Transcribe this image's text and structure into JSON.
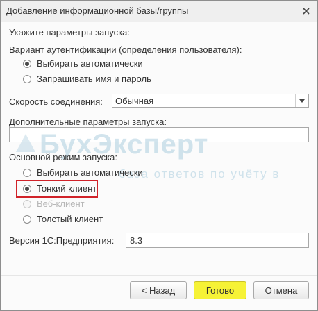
{
  "window": {
    "title": "Добавление информационной базы/группы",
    "close_icon": "close-icon"
  },
  "prompt": "Укажите параметры запуска:",
  "auth": {
    "label": "Вариант аутентификации (определения пользователя):",
    "options": [
      {
        "label": "Выбирать автоматически",
        "checked": true
      },
      {
        "label": "Запрашивать имя и пароль",
        "checked": false
      }
    ]
  },
  "speed": {
    "label": "Скорость соединения:",
    "value": "Обычная",
    "dropdown_icon": "chevron-down-icon"
  },
  "extra_params": {
    "label": "Дополнительные параметры запуска:",
    "value": ""
  },
  "watermark": {
    "logo": "БухЭксперт",
    "subtitle": "база ответов по учёту в"
  },
  "mode": {
    "label": "Основной режим запуска:",
    "options": [
      {
        "label": "Выбирать автоматически",
        "checked": false,
        "disabled": false
      },
      {
        "label": "Тонкий клиент",
        "checked": true,
        "disabled": false
      },
      {
        "label": "Веб-клиент",
        "checked": false,
        "disabled": true
      },
      {
        "label": "Толстый клиент",
        "checked": false,
        "disabled": false
      }
    ],
    "highlight_color": "#d1232a"
  },
  "version": {
    "label": "Версия 1С:Предприятия:",
    "value": "8.3"
  },
  "buttons": {
    "back": "< Назад",
    "done": "Готово",
    "cancel": "Отмена"
  },
  "colors": {
    "primary_button": "#f6f236",
    "highlight": "#d1232a"
  }
}
